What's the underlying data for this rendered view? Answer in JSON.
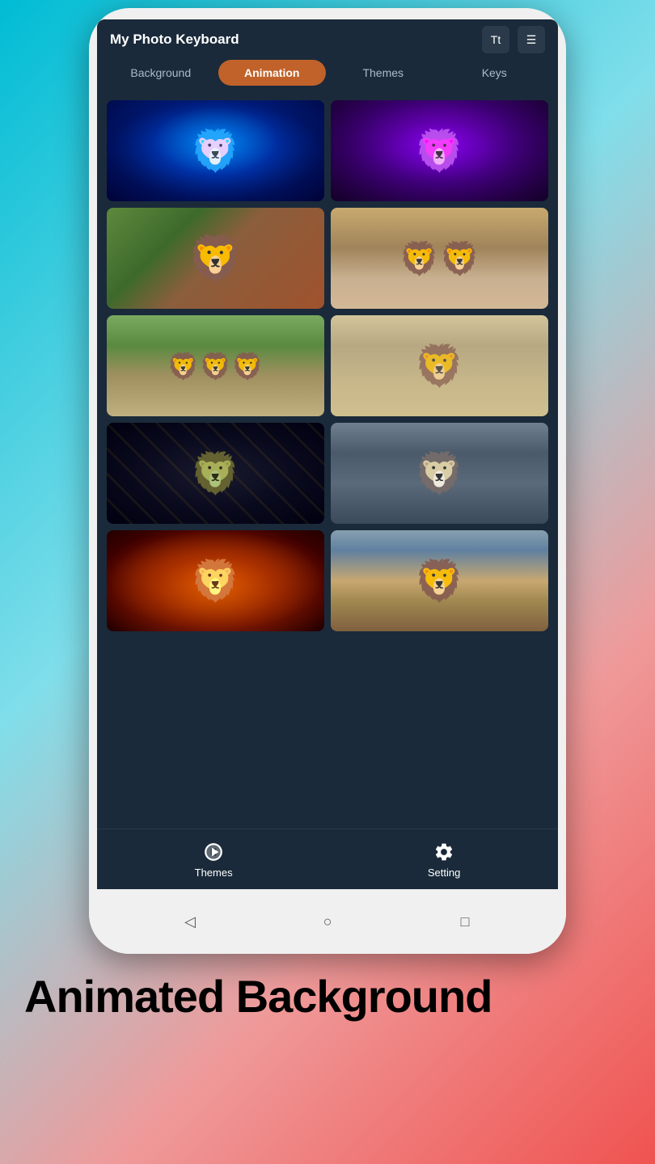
{
  "app": {
    "title": "My Photo Keyboard",
    "header_icon1": "Tt",
    "header_icon2": "☰"
  },
  "tabs": [
    {
      "id": "background",
      "label": "Background",
      "active": false
    },
    {
      "id": "animation",
      "label": "Animation",
      "active": true
    },
    {
      "id": "themes",
      "label": "Themes",
      "active": false
    },
    {
      "id": "keys",
      "label": "Keys",
      "active": false
    }
  ],
  "images": [
    {
      "id": "blue-lion",
      "alt": "Blue neon lion",
      "class": "img-blue-lion"
    },
    {
      "id": "purple-lion",
      "alt": "Purple neon lion",
      "class": "img-purple-lion"
    },
    {
      "id": "brown-lion",
      "alt": "Brown lion close-up",
      "class": "img-brown-lion"
    },
    {
      "id": "desert-lions",
      "alt": "Two lions in desert",
      "class": "img-desert-lions"
    },
    {
      "id": "pride-lions",
      "alt": "Lion pride on grass",
      "class": "img-pride-lions"
    },
    {
      "id": "sandy-lion",
      "alt": "Lion in sandy terrain",
      "class": "img-sandy-lion"
    },
    {
      "id": "electric-lion",
      "alt": "Electric lion with lightning",
      "class": "img-electric-lion"
    },
    {
      "id": "grey-lion",
      "alt": "Grey lion looking up",
      "class": "img-grey-lion"
    },
    {
      "id": "fire-lion",
      "alt": "Fire lion",
      "class": "img-fire-lion"
    },
    {
      "id": "savanna-lion",
      "alt": "Lion in savanna",
      "class": "img-savanna-lion"
    }
  ],
  "bottom_nav": [
    {
      "id": "themes",
      "label": "Themes",
      "icon": "themes"
    },
    {
      "id": "setting",
      "label": "Setting",
      "icon": "settings"
    }
  ],
  "phone_nav": [
    {
      "id": "back",
      "symbol": "◁"
    },
    {
      "id": "home",
      "symbol": "○"
    },
    {
      "id": "recents",
      "symbol": "□"
    }
  ],
  "footer": {
    "title": "Animated Background"
  },
  "colors": {
    "active_tab": "#c0622a",
    "screen_bg": "#1a2a3a",
    "nav_bg": "#1a2a3a"
  }
}
